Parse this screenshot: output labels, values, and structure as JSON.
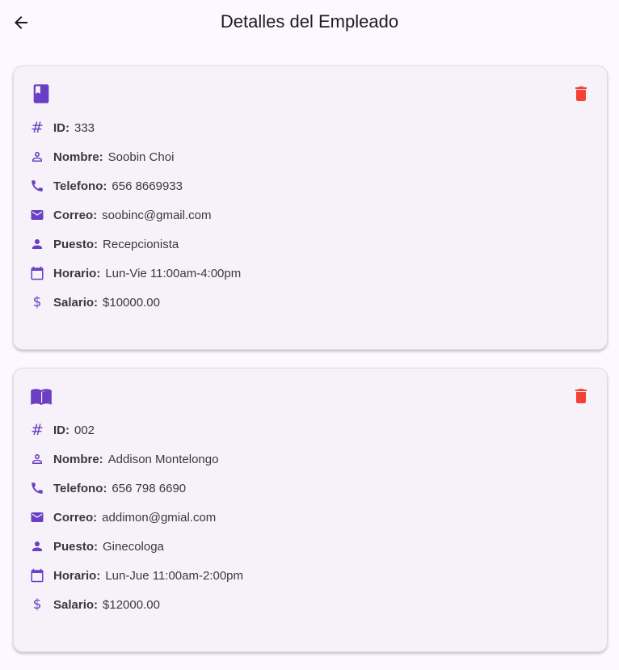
{
  "header": {
    "title": "Detalles del Empleado"
  },
  "colors": {
    "accent": "#6a3fc4",
    "delete": "#f44336",
    "background": "#fdf7ff",
    "card": "#f7f2fa"
  },
  "employees": [
    {
      "card_icon": "book-icon",
      "id_label": "ID:",
      "id_value": "333",
      "name_label": "Nombre:",
      "name_value": "Soobin Choi",
      "phone_label": "Telefono:",
      "phone_value": "656 8669933",
      "email_label": "Correo:",
      "email_value": "soobinc@gmail.com",
      "position_label": "Puesto:",
      "position_value": "Recepcionista",
      "schedule_label": "Horario:",
      "schedule_value": "Lun-Vie 11:00am-4:00pm",
      "salary_label": "Salario:",
      "salary_value": "$10000.00"
    },
    {
      "card_icon": "open-book-icon",
      "id_label": "ID:",
      "id_value": "002",
      "name_label": "Nombre:",
      "name_value": "Addison Montelongo",
      "phone_label": "Telefono:",
      "phone_value": "656 798 6690",
      "email_label": "Correo:",
      "email_value": "addimon@gmial.com",
      "position_label": "Puesto:",
      "position_value": "Ginecologa",
      "schedule_label": "Horario:",
      "schedule_value": "Lun-Jue 11:00am-2:00pm",
      "salary_label": "Salario:",
      "salary_value": "$12000.00"
    }
  ]
}
